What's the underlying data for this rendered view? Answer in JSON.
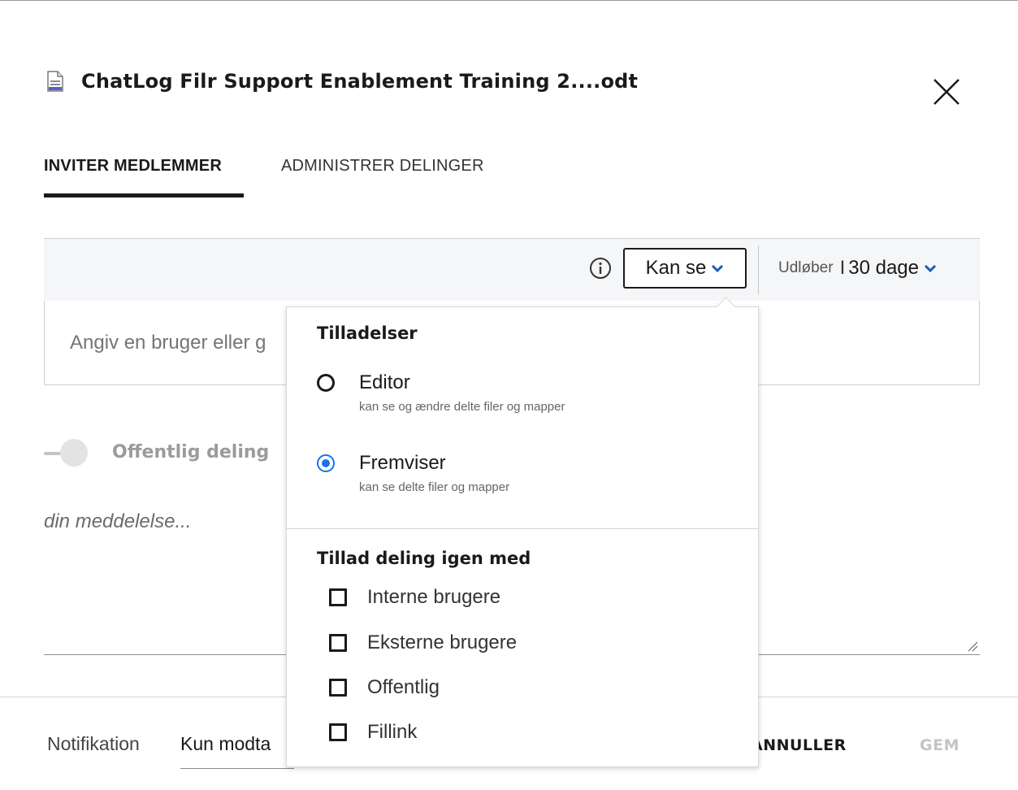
{
  "header": {
    "file_name": "ChatLog Filr Support Enablement Training 2....odt",
    "file_icon": "document-icon",
    "close_icon": "close-icon"
  },
  "tabs": [
    {
      "label": "INVITER MEDLEMMER",
      "active": true
    },
    {
      "label": "ADMINISTRER DELINGER",
      "active": false
    }
  ],
  "permission_bar": {
    "info_icon": "info-icon",
    "access_level": "Kan se",
    "expiry_label": "Udløber",
    "expiry_separator": "I",
    "expiry_value": "30 dage"
  },
  "user_input": {
    "placeholder": "Angiv en bruger eller g"
  },
  "public_share": {
    "label": "Offentlig deling",
    "enabled": false
  },
  "message": {
    "placeholder": "din meddelelse..."
  },
  "footer": {
    "notification_label": "Notifikation",
    "notification_value": "Kun modta",
    "cancel_label": "ANNULLER",
    "save_label": "GEM"
  },
  "permissions_dropdown": {
    "heading": "Tilladelser",
    "options": [
      {
        "label": "Editor",
        "description": "kan se og ændre delte filer og mapper",
        "selected": false
      },
      {
        "label": "Fremviser",
        "description": "kan se delte filer og mapper",
        "selected": true
      }
    ],
    "reshare_heading": "Tillad deling igen med",
    "reshare_options": [
      {
        "label": "Interne brugere",
        "checked": false
      },
      {
        "label": "Eksterne brugere",
        "checked": false
      },
      {
        "label": "Offentlig",
        "checked": false
      },
      {
        "label": "Fillink",
        "checked": false
      }
    ]
  },
  "colors": {
    "accent": "#1a73e8",
    "text": "#1a1a1a",
    "muted": "#6b6b6b",
    "bar_bg": "#f5f6f8"
  }
}
